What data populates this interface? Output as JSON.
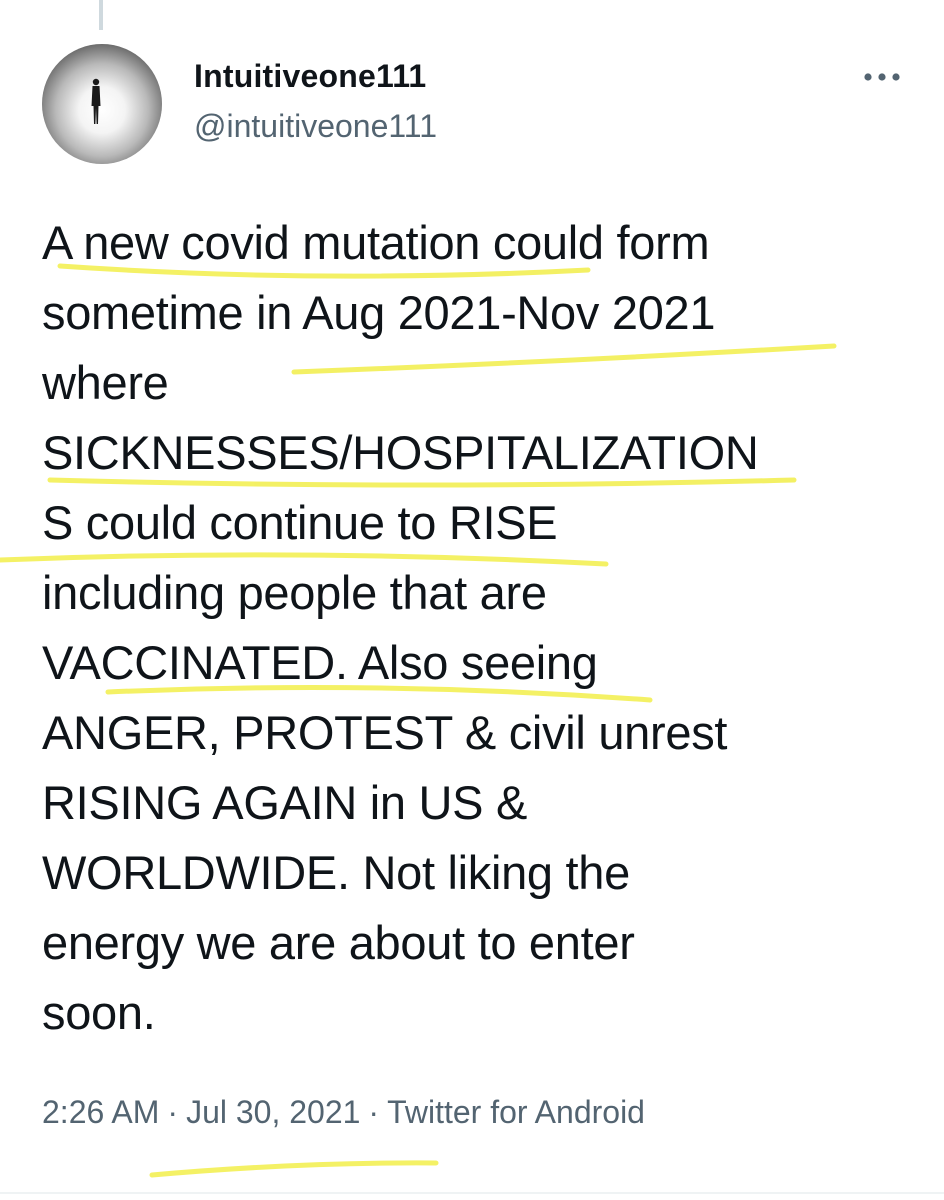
{
  "tweet": {
    "author": {
      "display_name": "Intuitiveone111",
      "handle": "@intuitiveone111",
      "avatar_icon": "avatar-silhouette-icon"
    },
    "more_icon": "more-options-icon",
    "text_lines": [
      "A new covid mutation could form",
      "sometime in Aug 2021-Nov 2021",
      "where",
      "SICKNESSES/HOSPITALIZATION",
      "S could continue to RISE",
      "including people that are",
      "VACCINATED. Also seeing",
      "ANGER, PROTEST & civil unrest",
      "RISING AGAIN in US &",
      "WORLDWIDE. Not liking the",
      "energy we are about to enter",
      "soon."
    ],
    "time": "2:26 AM",
    "separator": "·",
    "date": "Jul 30, 2021",
    "client": "Twitter for Android"
  },
  "colors": {
    "text": "#0f1419",
    "secondary": "#536471",
    "highlight": "#f2ee4a",
    "thread_line": "#cfd9de"
  }
}
